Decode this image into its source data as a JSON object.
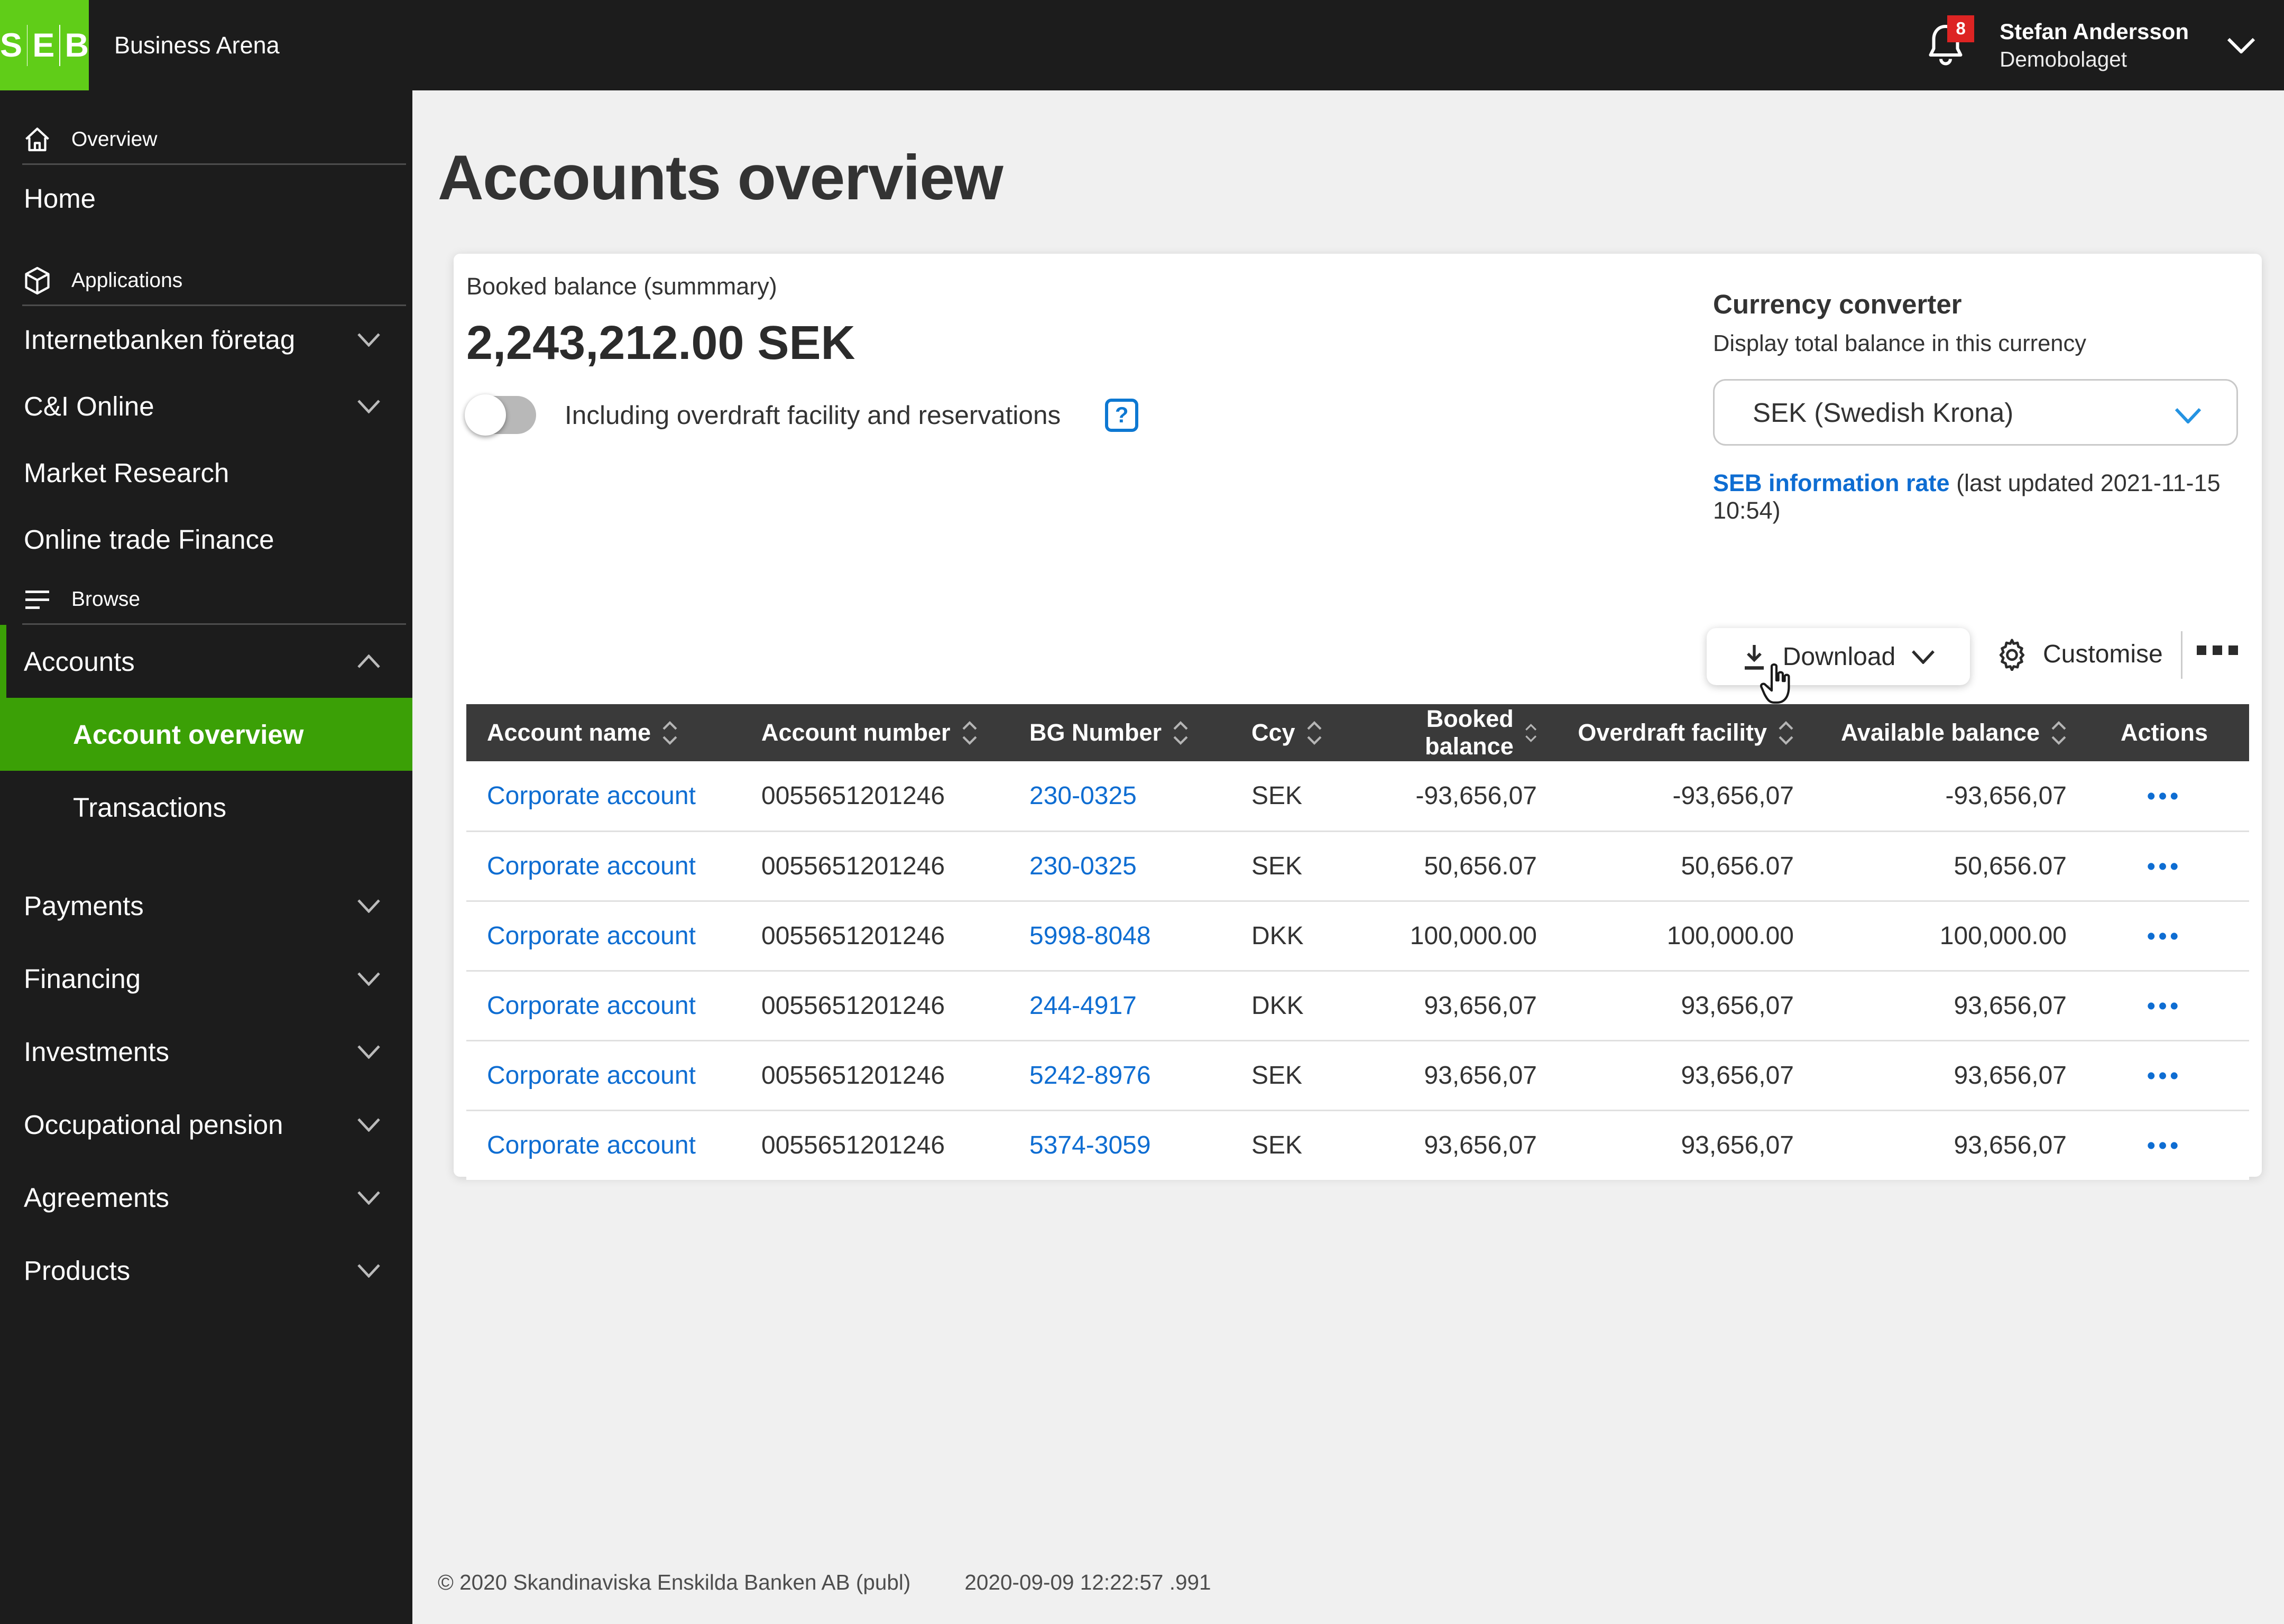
{
  "colors": {
    "brand_green": "#60cd18",
    "active_green": "#3ba006",
    "badge_red": "#dd2423",
    "link_blue": "#0e6dd2",
    "table_header_bg": "#3a3a3a",
    "topbar_bg": "#1c1c1c"
  },
  "topbar": {
    "logo_text": "SEB",
    "app_title": "Business Arena",
    "notification_count": "8",
    "user_name": "Stefan Andersson",
    "user_org": "Demobolaget"
  },
  "sidebar": {
    "overview_label": "Overview",
    "home_label": "Home",
    "applications_label": "Applications",
    "app_items": [
      {
        "label": "Internetbanken företag"
      },
      {
        "label": "C&I Online"
      },
      {
        "label": "Market Research"
      },
      {
        "label": "Online trade Finance"
      }
    ],
    "browse_label": "Browse",
    "accounts_label": "Accounts",
    "accounts_children": [
      {
        "label": "Account overview"
      },
      {
        "label": "Transactions"
      }
    ],
    "groups": [
      {
        "label": "Payments"
      },
      {
        "label": "Financing"
      },
      {
        "label": "Investments"
      },
      {
        "label": "Occupational pension"
      },
      {
        "label": "Agreements"
      },
      {
        "label": "Products"
      }
    ]
  },
  "page": {
    "title": "Accounts overview"
  },
  "summary": {
    "label": "Booked balance (summmary)",
    "amount": "2,243,212.00 SEK",
    "toggle_label": "Including overdraft facility and reservations",
    "help_glyph": "?"
  },
  "converter": {
    "title": "Currency converter",
    "subtitle": "Display total balance in this currency",
    "selected_currency": "SEK (Swedish Krona)",
    "rate_link": "SEB information rate",
    "rate_suffix": " (last updated 2021-11-15 10:54)"
  },
  "toolbar": {
    "download_label": "Download",
    "customise_label": "Customise"
  },
  "table": {
    "columns": {
      "account_name": "Account name",
      "account_number": "Account number",
      "bg_number": "BG Number",
      "ccy": "Ccy",
      "booked_balance": "Booked balance",
      "overdraft_facility": "Overdraft facility",
      "available_balance": "Available balance",
      "actions": "Actions"
    },
    "rows": [
      {
        "name": "Corporate account",
        "number": "0055651201246",
        "bg": "230-0325",
        "ccy": "SEK",
        "booked": "-93,656,07",
        "overdraft": "-93,656,07",
        "available": "-93,656,07",
        "dots": "•••"
      },
      {
        "name": "Corporate account",
        "number": "0055651201246",
        "bg": "230-0325",
        "ccy": "SEK",
        "booked": "50,656.07",
        "overdraft": "50,656.07",
        "available": "50,656.07",
        "dots": "•••"
      },
      {
        "name": "Corporate account",
        "number": "0055651201246",
        "bg": "5998-8048",
        "ccy": "DKK",
        "booked": "100,000.00",
        "overdraft": "100,000.00",
        "available": "100,000.00",
        "dots": "•••"
      },
      {
        "name": "Corporate account",
        "number": "0055651201246",
        "bg": "244-4917",
        "ccy": "DKK",
        "booked": "93,656,07",
        "overdraft": "93,656,07",
        "available": "93,656,07",
        "dots": "•••"
      },
      {
        "name": "Corporate account",
        "number": "0055651201246",
        "bg": "5242-8976",
        "ccy": "SEK",
        "booked": "93,656,07",
        "overdraft": "93,656,07",
        "available": "93,656,07",
        "dots": "•••"
      },
      {
        "name": "Corporate account",
        "number": "0055651201246",
        "bg": "5374-3059",
        "ccy": "SEK",
        "booked": "93,656,07",
        "overdraft": "93,656,07",
        "available": "93,656,07",
        "dots": "•••"
      }
    ]
  },
  "footer": {
    "copyright": "© 2020 Skandinaviska Enskilda Banken AB (publ)",
    "timestamp": "2020-09-09 12:22:57 .991"
  }
}
